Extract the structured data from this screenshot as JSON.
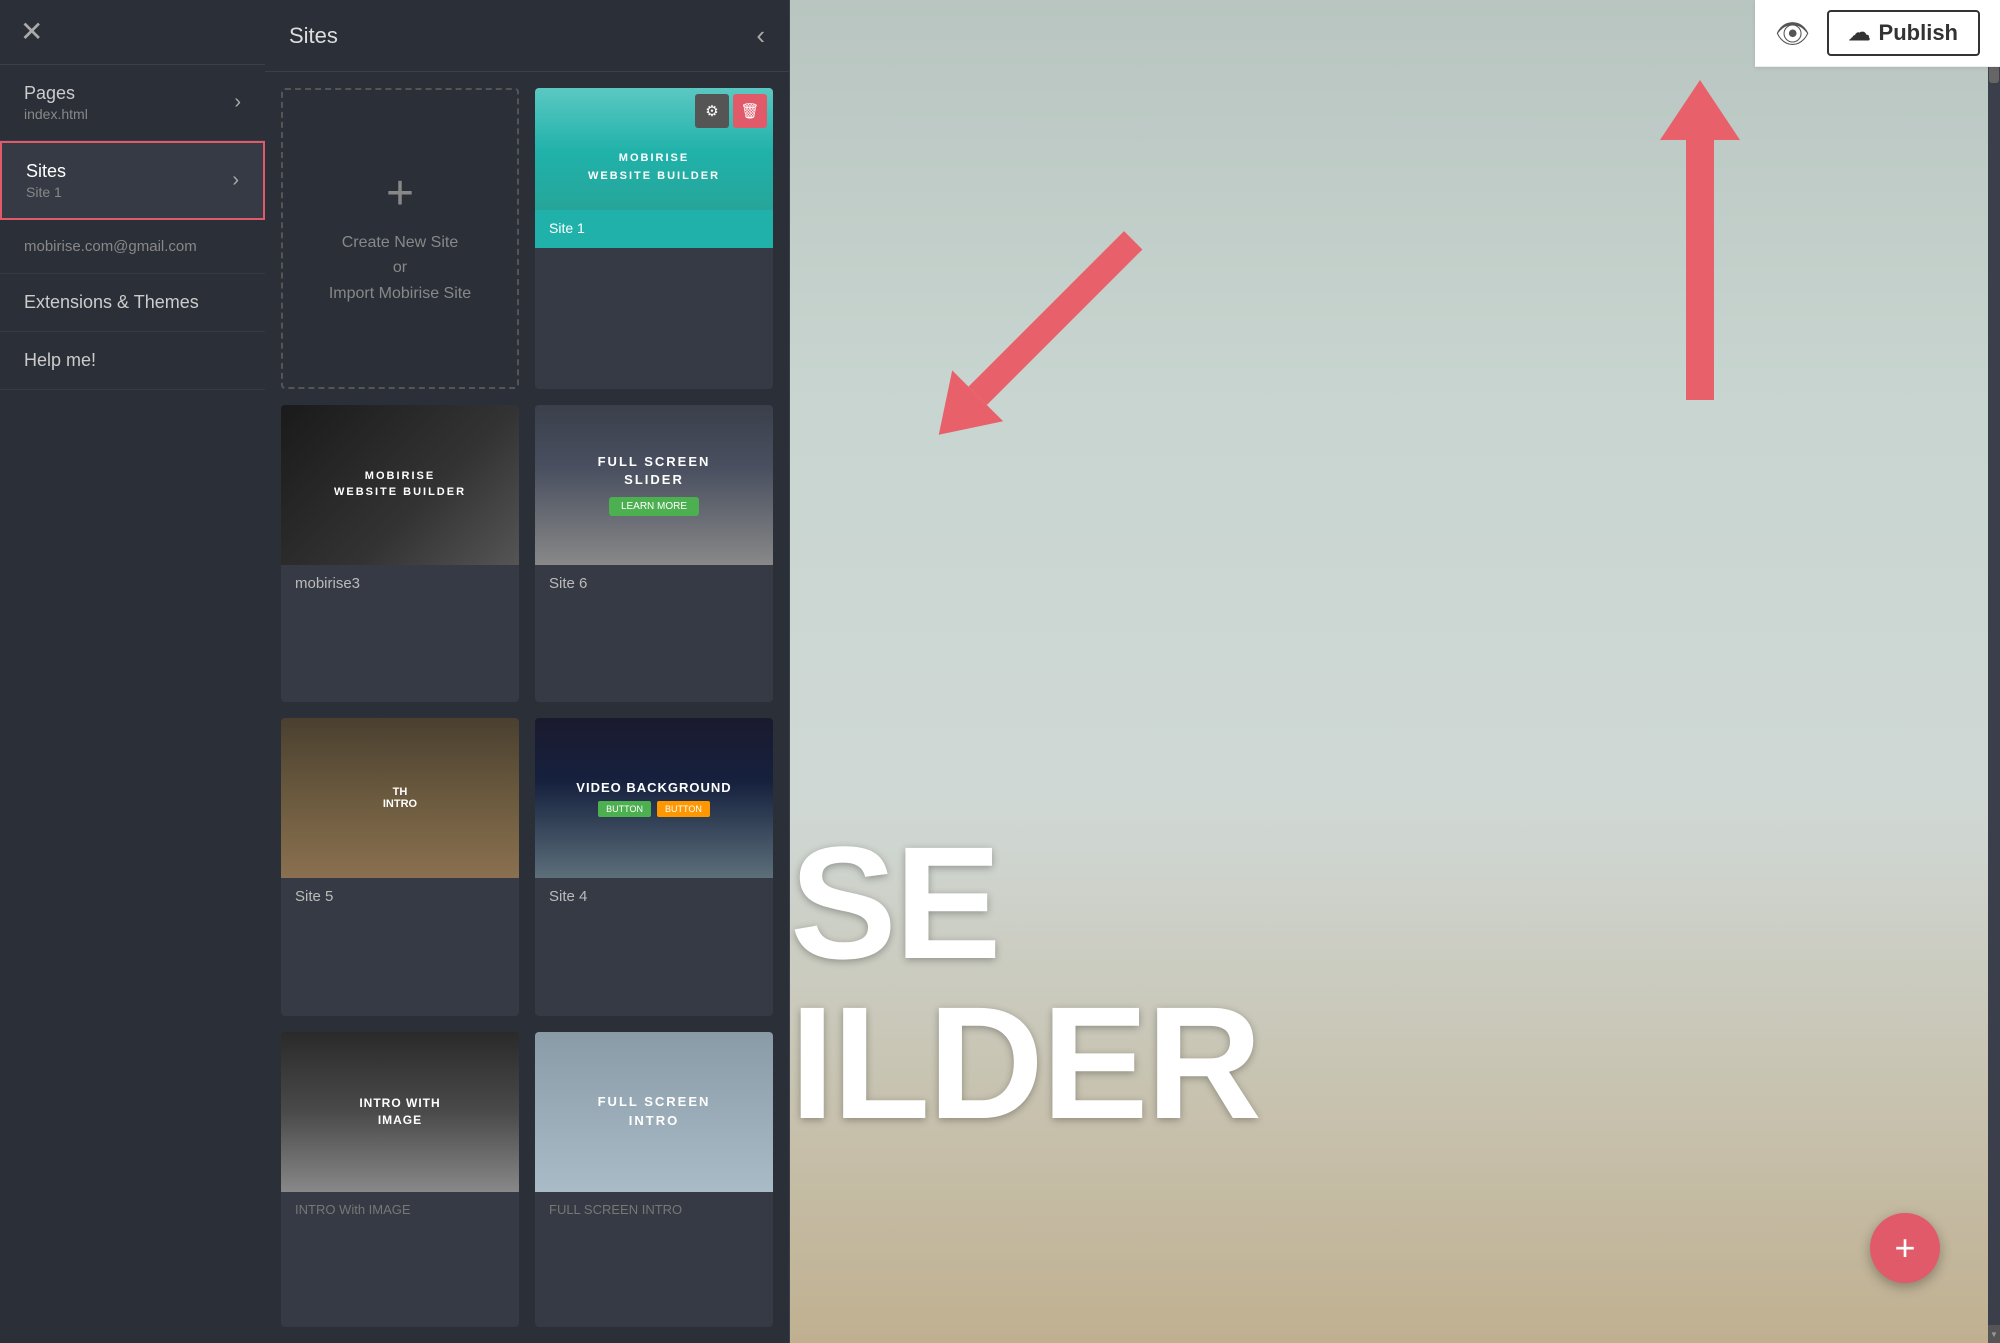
{
  "sidebar": {
    "close_label": "✕",
    "items": [
      {
        "id": "pages",
        "label": "Pages",
        "sub": "index.html",
        "chevron": "›",
        "active": false
      },
      {
        "id": "sites",
        "label": "Sites",
        "sub": "Site 1",
        "chevron": "›",
        "active": true
      }
    ],
    "email": "mobirise.com@gmail.com",
    "extensions_label": "Extensions & Themes",
    "help_label": "Help me!"
  },
  "sites_panel": {
    "title": "Sites",
    "close_icon": "‹",
    "cards": [
      {
        "id": "create",
        "type": "create",
        "plus": "+",
        "label": "Create New Site",
        "or": "or",
        "import": "Import Mobirise Site"
      },
      {
        "id": "site1",
        "type": "site",
        "thumb_type": "site1",
        "label": "Site 1",
        "title": "MOBIRISE\nWEBSITE BUILDER"
      },
      {
        "id": "mobirise3",
        "type": "site",
        "thumb_type": "mobirise3",
        "label": "mobirise3",
        "title": "MOBIRISE\nWEBSITE BUILDER"
      },
      {
        "id": "site6",
        "type": "site",
        "thumb_type": "fullscreen",
        "label": "Site 6",
        "title": "FULL SCREEN\nSLIDER"
      },
      {
        "id": "site5",
        "type": "site",
        "thumb_type": "site5",
        "label": "Site 5",
        "title": "TH\nINTRO"
      },
      {
        "id": "site4",
        "type": "site",
        "thumb_type": "video",
        "label": "Site 4",
        "title": "VIDEO BACKGROUND"
      },
      {
        "id": "intro-image",
        "type": "site",
        "thumb_type": "intro-image",
        "label": "",
        "title": "INTRO WITH\nIMAGE"
      },
      {
        "id": "full-intro",
        "type": "site",
        "thumb_type": "full-intro",
        "label": "",
        "title": "FULL SCREEN\nINTRO"
      }
    ]
  },
  "topbar": {
    "preview_icon": "👁",
    "publish_icon": "☁",
    "publish_label": "Publish"
  },
  "main": {
    "hero_line1": "SE",
    "hero_line2": "ILDER"
  },
  "fab": {
    "label": "+"
  }
}
